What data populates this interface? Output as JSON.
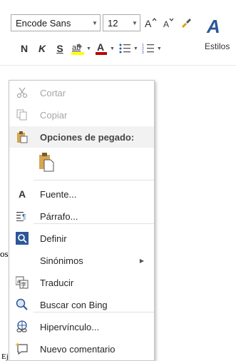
{
  "mini_toolbar": {
    "font_name": "Encode Sans",
    "font_size": "12",
    "bold_label": "N",
    "italic_label": "K",
    "underline_label": "S",
    "styles_label": "Estilos"
  },
  "background_text": {
    "left_fragment": "os",
    "bottom_fragment": "Ejec..."
  },
  "context_menu": {
    "cut": "Cortar",
    "copy": "Copiar",
    "paste_options": "Opciones de pegado:",
    "font": "Fuente...",
    "paragraph": "Párrafo...",
    "define": "Definir",
    "synonyms": "Sinónimos",
    "translate": "Traducir",
    "search_bing": "Buscar con Bing",
    "hyperlink": "Hipervínculo...",
    "new_comment": "Nuevo comentario"
  },
  "colors": {
    "accent": "#2b579a",
    "highlight_yellow": "#ffff00",
    "font_color_red": "#c00000",
    "disabled_text": "#a6a6a6"
  }
}
